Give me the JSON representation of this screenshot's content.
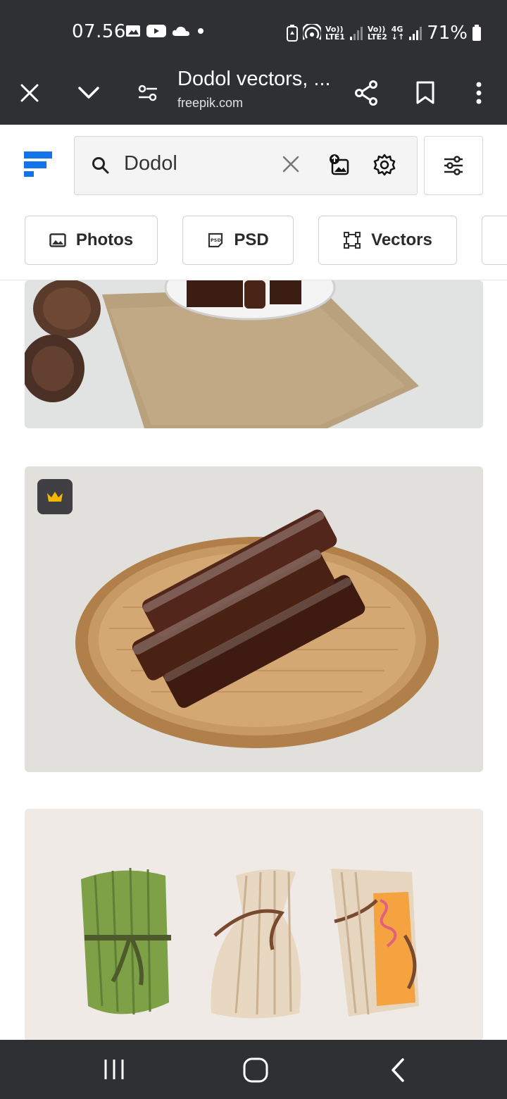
{
  "status_bar": {
    "time": "07.56",
    "net1_top": "Vo))",
    "net1_bottom": "LTE1",
    "net2_top": "Vo))",
    "net2_bottom": "LTE2",
    "net3_top": "4G",
    "net3_bottom": "↓↑",
    "battery": "71%"
  },
  "browser_toolbar": {
    "title": "Dodol vectors, ...",
    "url": "freepik.com"
  },
  "search": {
    "query": "Dodol"
  },
  "filter_chips": [
    {
      "label": "Photos",
      "icon": "image-icon"
    },
    {
      "label": "PSD",
      "icon": "psd-icon"
    },
    {
      "label": "Vectors",
      "icon": "vector-icon"
    }
  ],
  "results": [
    {
      "subject": "dodol on plate with pine cones"
    },
    {
      "subject": "wrapped dodol rolls on woven tray",
      "premium": true
    },
    {
      "subject": "dodol wrapped in leaves illustration"
    }
  ],
  "colors": {
    "chrome": "#2f3033",
    "brand": "#1273eb",
    "premium_badge": "#f5b800"
  }
}
